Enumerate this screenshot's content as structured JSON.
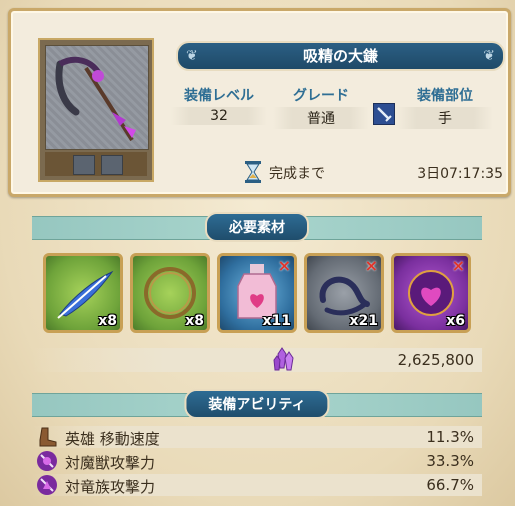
{
  "item": {
    "name": "吸精の大鎌",
    "level_label": "装備レベル",
    "level_value": "32",
    "grade_label": "グレード",
    "grade_value": "普通",
    "slot_label": "装備部位",
    "slot_value": "手",
    "timer_label": "完成まで",
    "timer_value": "3日07:17:35"
  },
  "materials_section": {
    "title": "必要素材",
    "items": [
      {
        "icon": "feather-icon",
        "qty": "x8",
        "lacking": false
      },
      {
        "icon": "wreath-icon",
        "qty": "x8",
        "lacking": true
      },
      {
        "icon": "potion-icon",
        "qty": "x11",
        "lacking": true
      },
      {
        "icon": "horn-icon",
        "qty": "x21",
        "lacking": true
      },
      {
        "icon": "heart-orb-icon",
        "qty": "x6",
        "lacking": false
      }
    ],
    "lack_mark": "×",
    "cost_value": "2,625,800"
  },
  "abilities_section": {
    "title": "装備アビリティ",
    "rows": [
      {
        "icon": "boot-icon",
        "name": "英雄 移動速度",
        "value": "11.3%"
      },
      {
        "icon": "beast-sword-icon",
        "name": "対魔獣攻撃力",
        "value": "33.3%"
      },
      {
        "icon": "dragon-sword-icon",
        "name": "対竜族攻撃力",
        "value": "66.7%"
      }
    ]
  },
  "colors": {
    "accent_blue": "#1f4a68",
    "section_teal": "#a9d5cd",
    "frame_gold": "#c8a055",
    "lack_red": "#e0342a"
  }
}
